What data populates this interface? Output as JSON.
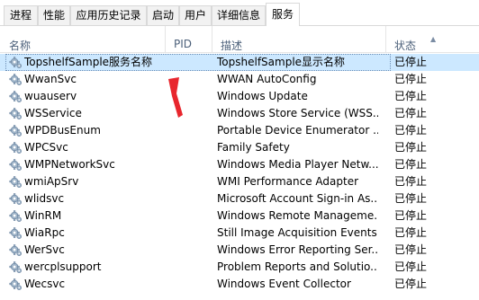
{
  "tabs": [
    {
      "label": "进程",
      "active": false
    },
    {
      "label": "性能",
      "active": false
    },
    {
      "label": "应用历史记录",
      "active": false
    },
    {
      "label": "启动",
      "active": false
    },
    {
      "label": "用户",
      "active": false
    },
    {
      "label": "详细信息",
      "active": false
    },
    {
      "label": "服务",
      "active": true
    }
  ],
  "columns": {
    "name": "名称",
    "pid": "PID",
    "description": "描述",
    "status": "状态"
  },
  "sort_indicator": "^",
  "services": [
    {
      "name": "TopshelfSample服务名称",
      "description": "TopshelfSample显示名称",
      "status": "已停止",
      "selected": true
    },
    {
      "name": "WwanSvc",
      "description": "WWAN AutoConfig",
      "status": "已停止"
    },
    {
      "name": "wuauserv",
      "description": "Windows Update",
      "status": "已停止"
    },
    {
      "name": "WSService",
      "description": "Windows Store Service (WSS...",
      "status": "已停止"
    },
    {
      "name": "WPDBusEnum",
      "description": "Portable Device Enumerator ...",
      "status": "已停止"
    },
    {
      "name": "WPCSvc",
      "description": "Family Safety",
      "status": "已停止"
    },
    {
      "name": "WMPNetworkSvc",
      "description": "Windows Media Player Netw...",
      "status": "已停止"
    },
    {
      "name": "wmiApSrv",
      "description": "WMI Performance Adapter",
      "status": "已停止"
    },
    {
      "name": "wlidsvc",
      "description": "Microsoft Account Sign-in As...",
      "status": "已停止"
    },
    {
      "name": "WinRM",
      "description": "Windows Remote Manageme...",
      "status": "已停止"
    },
    {
      "name": "WiaRpc",
      "description": "Still Image Acquisition Events",
      "status": "已停止"
    },
    {
      "name": "WerSvc",
      "description": "Windows Error Reporting Ser...",
      "status": "已停止"
    },
    {
      "name": "wercplsupport",
      "description": "Problem Reports and Solutio...",
      "status": "已停止"
    },
    {
      "name": "Wecsvc",
      "description": "Windows Event Collector",
      "status": "已停止"
    }
  ],
  "icons": {
    "service": "gear-icon",
    "annotation": "red-arrow-icon"
  },
  "colors": {
    "selected_row": "#cce8ff",
    "header_text": "#4c607a",
    "annotation_arrow": "#e8262d"
  }
}
